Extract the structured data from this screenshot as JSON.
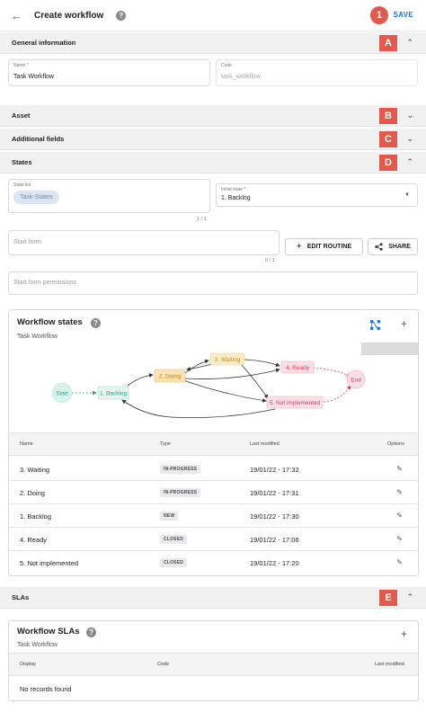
{
  "header": {
    "back_icon": "arrow-left-icon",
    "title": "Create workflow",
    "help": "?",
    "badge": "1",
    "save_label": "SAVE"
  },
  "sections": {
    "general": {
      "label": "General information",
      "badge": "A",
      "chevron": "^"
    },
    "asset": {
      "label": "Asset",
      "badge": "B",
      "chevron": "v"
    },
    "additional": {
      "label": "Additional fields",
      "badge": "C",
      "chevron": "v"
    },
    "states": {
      "label": "States",
      "badge": "D",
      "chevron": "^"
    },
    "slas": {
      "label": "SLAs",
      "badge": "E",
      "chevron": "^"
    }
  },
  "general": {
    "name_label": "Name *",
    "name_value": "Task Workflow",
    "code_label": "Code",
    "code_value": "task_workflow"
  },
  "states": {
    "state_list_label": "State list",
    "state_list_chip": "Task-States",
    "state_list_counter": "1 / 1",
    "initial_state_label": "Initial state *",
    "initial_state_value": "1. Backlog",
    "start_form_placeholder": "Start form",
    "start_form_counter": "0 / 1",
    "edit_routine_label": "EDIT ROUTINE",
    "share_label": "SHARE",
    "permissions_placeholder": "Start form permissions"
  },
  "workflow_states": {
    "title": "Workflow states",
    "subtitle": "Task Workflow",
    "help": "?",
    "plus": "+",
    "diagram": {
      "nodes": {
        "start": "Start",
        "backlog": "1. Backlog",
        "doing": "2. Doing",
        "waiting": "3. Waiting",
        "ready": "4. Ready",
        "notimpl": "5. Not implemented",
        "end": "End"
      }
    },
    "columns": {
      "name": "Name",
      "type": "Type",
      "modified": "Last modified",
      "options": "Options"
    },
    "rows": [
      {
        "name": "3. Waiting",
        "type": "IN-PROGRESS",
        "modified": "19/01/22 - 17:32"
      },
      {
        "name": "2. Doing",
        "type": "IN-PROGRESS",
        "modified": "19/01/22 - 17:31"
      },
      {
        "name": "1. Backlog",
        "type": "NEW",
        "modified": "19/01/22 - 17:30"
      },
      {
        "name": "4. Ready",
        "type": "CLOSED",
        "modified": "19/01/22 - 17:06"
      },
      {
        "name": "5. Not implemented",
        "type": "CLOSED",
        "modified": "19/01/22 - 17:20"
      }
    ]
  },
  "workflow_slas": {
    "title": "Workflow SLAs",
    "subtitle": "Task Workflow",
    "help": "?",
    "plus": "+",
    "columns": {
      "display": "Display",
      "code": "Code",
      "modified": "Last modified"
    },
    "empty_text": "No records found"
  },
  "colors": {
    "accent": "#1976d2",
    "badge": "#e05a4e",
    "section_bg": "#f1f1f2",
    "start_node": "#d8f3ec",
    "doing_node": "#fde3b5",
    "ready_node": "#fde0e6"
  }
}
